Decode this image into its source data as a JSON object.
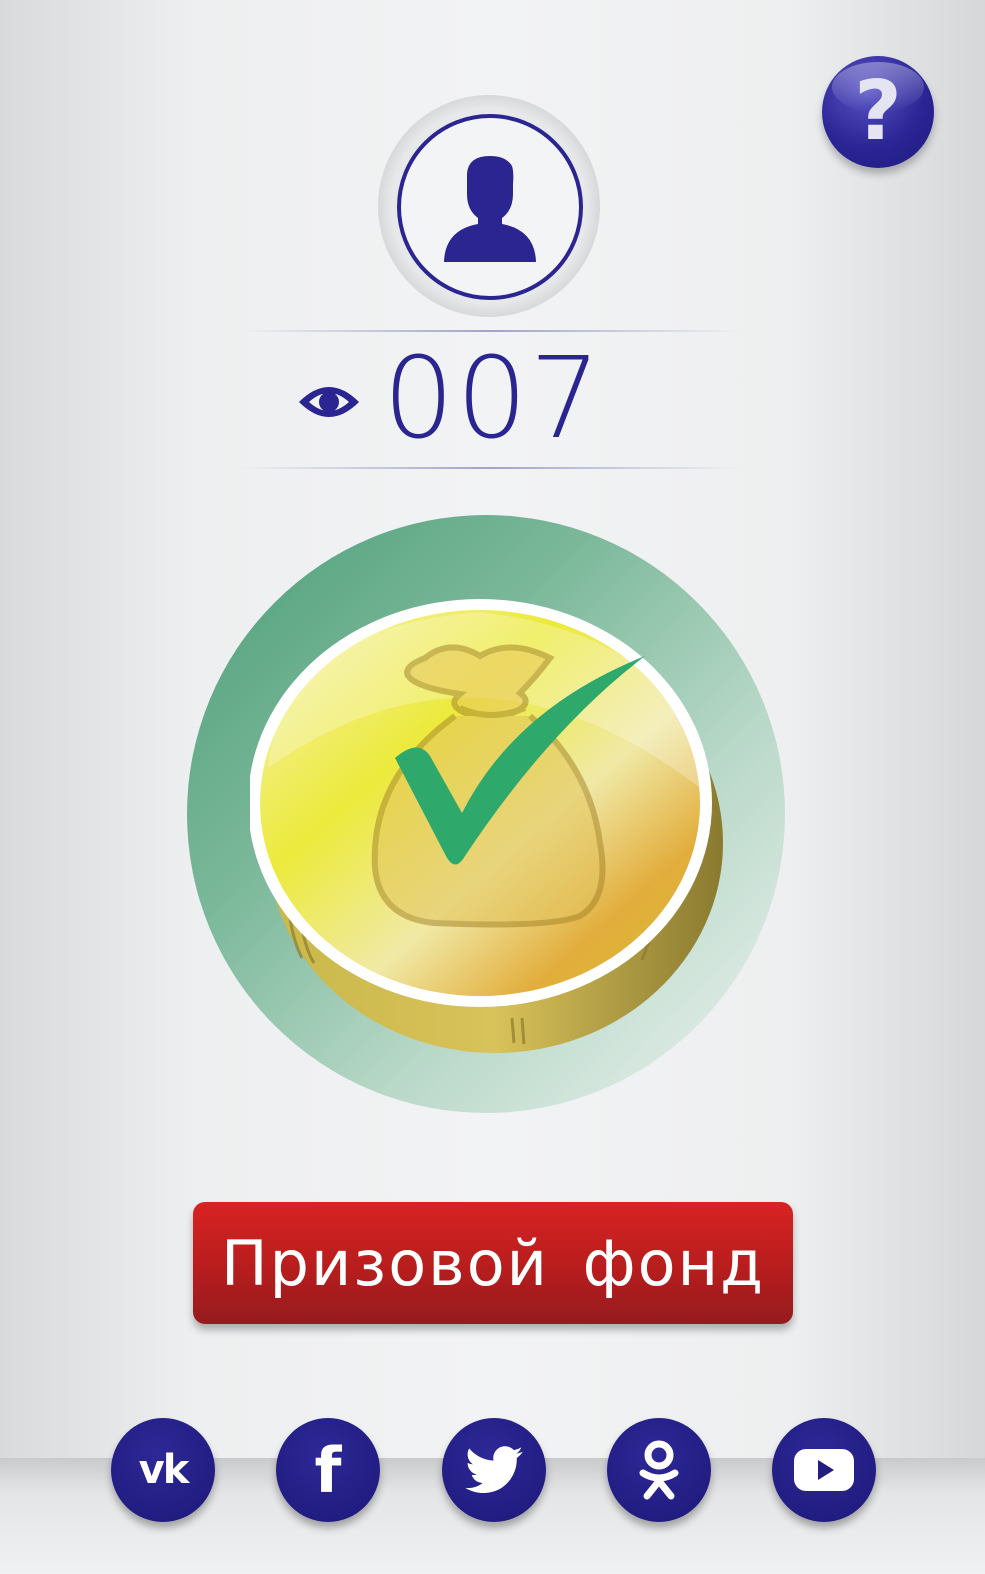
{
  "header": {
    "help_label": "?"
  },
  "profile": {
    "views_count": "007"
  },
  "main": {
    "prize_button_label": "Призовой фонд"
  },
  "social": {
    "items": [
      {
        "name": "vk",
        "label": "vk"
      },
      {
        "name": "facebook",
        "label": "f"
      },
      {
        "name": "twitter",
        "label": ""
      },
      {
        "name": "odnoklassniki",
        "label": ""
      },
      {
        "name": "youtube",
        "label": ""
      }
    ]
  },
  "colors": {
    "brand_navy": "#2b2592",
    "accent_red": "#c41f1f",
    "halo_green": "#5fa985",
    "check_green": "#2fa86b",
    "coin_gold": "#e8d84a"
  }
}
